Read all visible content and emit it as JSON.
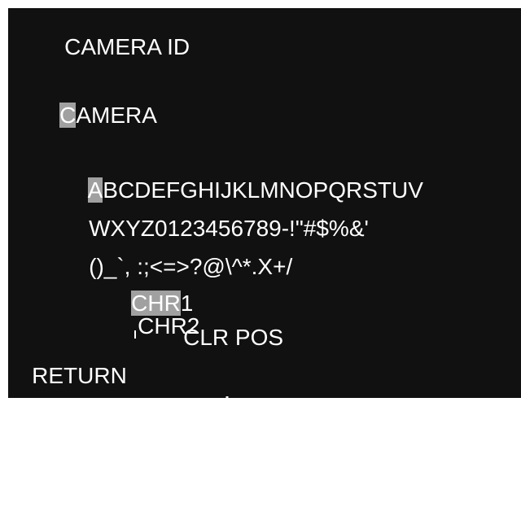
{
  "title": "CAMERA ID",
  "camera_id": {
    "cursor_char": "C",
    "rest": "AMERA"
  },
  "charset": {
    "row1": {
      "cursor_char": "A",
      "rest": "BCDEFGHIJKLMNOPQRSTUV"
    },
    "row2": "WXYZ0123456789-!\"#$%&'",
    "row3": "()_`, :;<=>?@\\^*.X+/"
  },
  "buttons": {
    "chr1_highlight": "CHR",
    "chr1_rest": "1",
    "chr2": "CHR2",
    "clr_pos": "CLR POS",
    "return": "RETURN"
  },
  "icons": {
    "enter": "enter-arrow-icon",
    "separator": "separator-tick"
  },
  "colors": {
    "background": "#111111",
    "text": "#ffffff",
    "highlight": "#a0a0a0"
  }
}
